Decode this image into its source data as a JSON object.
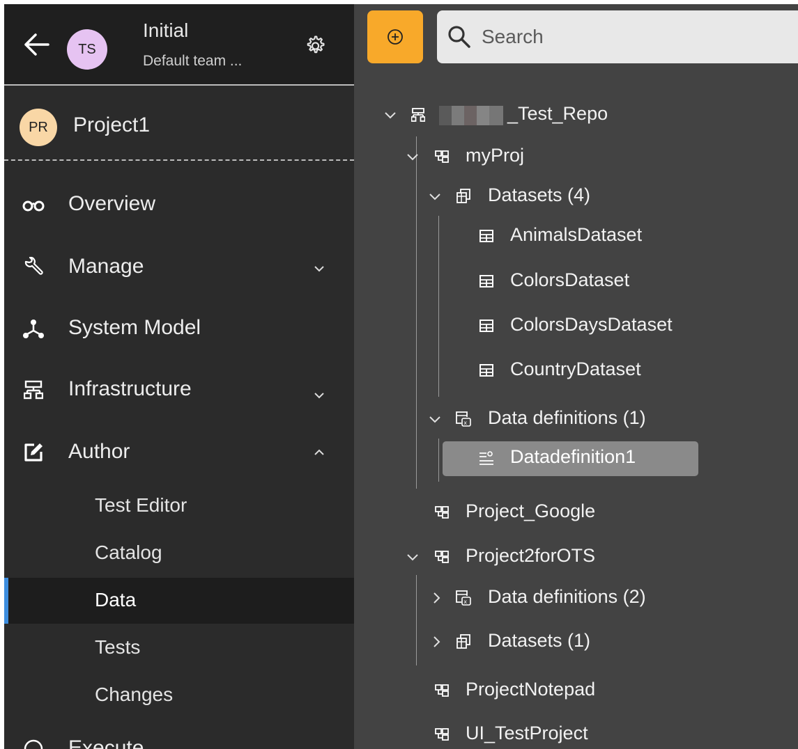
{
  "header": {
    "team_name": "Initial",
    "team_sub": "Default team ...",
    "team_avatar": "TS",
    "back_icon": "arrow-left-icon",
    "settings_icon": "gear-icon"
  },
  "project": {
    "avatar": "PR",
    "name": "Project1"
  },
  "nav": {
    "overview": "Overview",
    "manage": "Manage",
    "system_model": "System Model",
    "infrastructure": "Infrastructure",
    "author": "Author",
    "execute": "Execute"
  },
  "author_sub": {
    "test_editor": "Test Editor",
    "catalog": "Catalog",
    "data": "Data",
    "tests": "Tests",
    "changes": "Changes"
  },
  "toolbar": {
    "add_icon": "plus-circle-icon",
    "search_placeholder": "Search"
  },
  "tree": {
    "repo": "_Test_Repo",
    "myproj": "myProj",
    "datasets": "Datasets (4)",
    "animals": "AnimalsDataset",
    "colors": "ColorsDataset",
    "colorsdays": "ColorsDaysDataset",
    "country": "CountryDataset",
    "datadefs": "Data definitions (1)",
    "datadef1": "Datadefinition1",
    "project_google": "Project_Google",
    "project2": "Project2forOTS",
    "p2_datadefs": "Data definitions (2)",
    "p2_datasets": "Datasets (1)",
    "notepad": "ProjectNotepad",
    "ui_test": "UI_TestProject"
  },
  "colors": {
    "accent": "#f8a92a",
    "active_bar": "#3c8dde",
    "sidebar_bg": "#2b2b2b",
    "panel_bg": "#434343"
  }
}
